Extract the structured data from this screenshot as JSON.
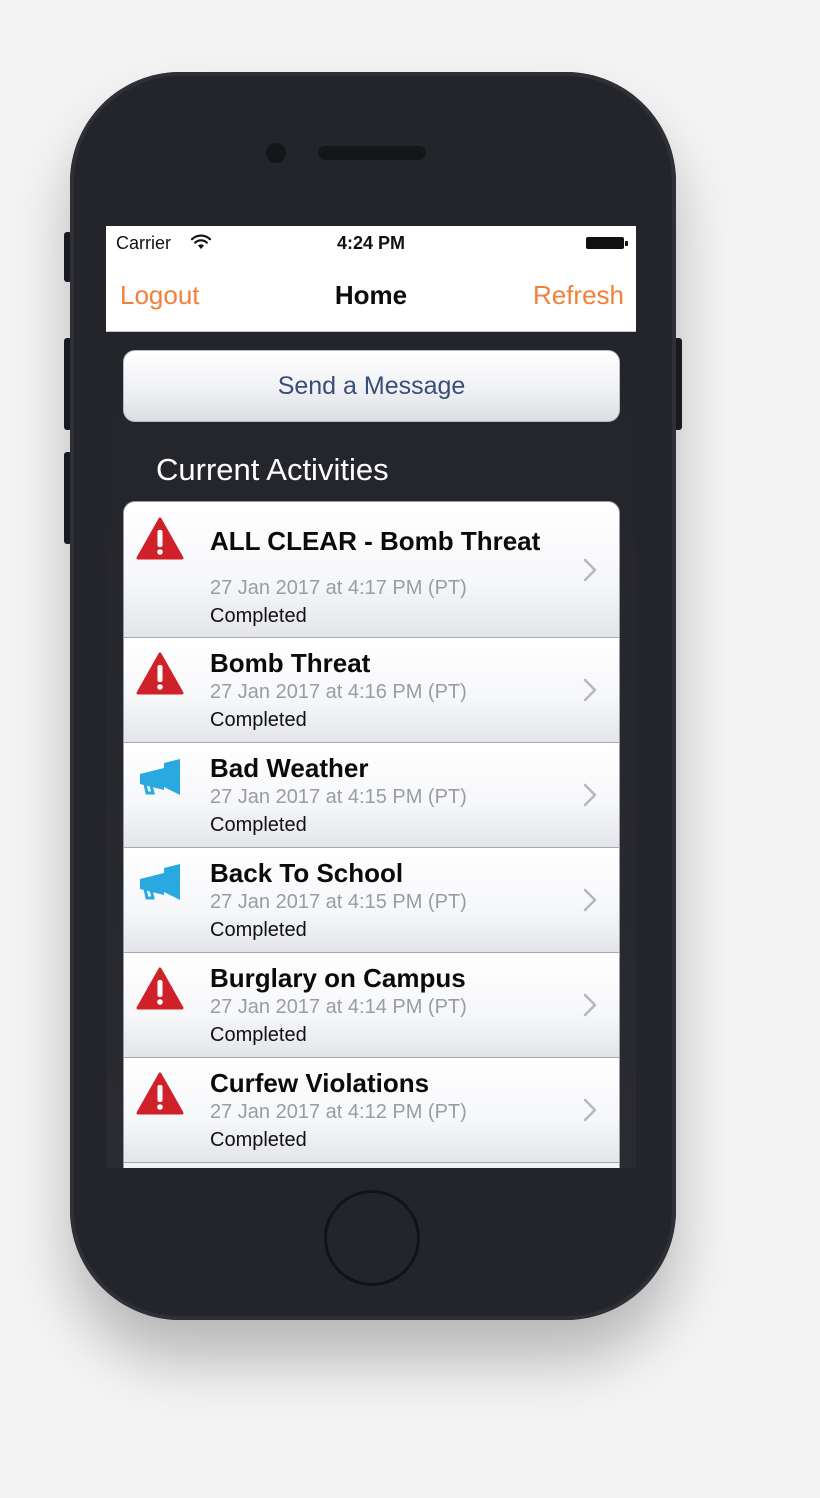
{
  "status_bar": {
    "carrier": "Carrier",
    "time": "4:24 PM"
  },
  "nav": {
    "left_label": "Logout",
    "title": "Home",
    "right_label": "Refresh",
    "accent_color": "#f27f3a"
  },
  "send_button_label": "Send a Message",
  "section_title": "Current Activities",
  "activities": [
    {
      "icon": "warning-icon",
      "title": "ALL CLEAR - Bomb Threat",
      "time": "27 Jan 2017 at 4:17 PM (PT)",
      "status": "Completed"
    },
    {
      "icon": "warning-icon",
      "title": "Bomb Threat",
      "time": "27 Jan 2017 at 4:16 PM (PT)",
      "status": "Completed"
    },
    {
      "icon": "megaphone-icon",
      "title": "Bad Weather",
      "time": "27 Jan 2017 at 4:15 PM (PT)",
      "status": "Completed"
    },
    {
      "icon": "megaphone-icon",
      "title": "Back To School",
      "time": "27 Jan 2017 at 4:15 PM (PT)",
      "status": "Completed"
    },
    {
      "icon": "warning-icon",
      "title": "Burglary on Campus",
      "time": "27 Jan 2017 at 4:14 PM (PT)",
      "status": "Completed"
    },
    {
      "icon": "warning-icon",
      "title": "Curfew Violations",
      "time": "27 Jan 2017 at 4:12 PM (PT)",
      "status": "Completed"
    }
  ],
  "colors": {
    "warning": "#d0202a",
    "megaphone": "#2aa9e0",
    "send_text": "#3a4d78"
  }
}
